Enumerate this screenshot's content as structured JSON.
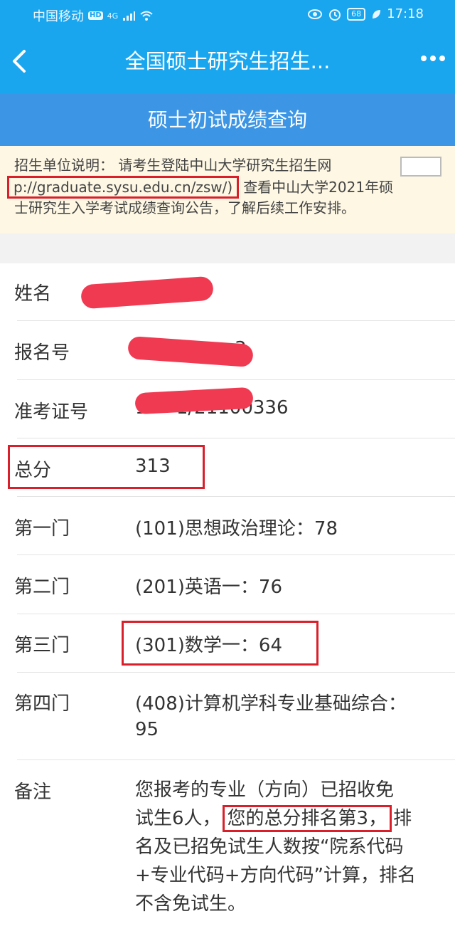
{
  "status_bar": {
    "carrier": "中国移动",
    "hd_badge": "HD",
    "net_badge": "4G",
    "battery": "68",
    "time": "17:18"
  },
  "nav": {
    "title": "全国硕士研究生招生..."
  },
  "sub_header": "硕士初试成绩查询",
  "notice": {
    "line1": "招生单位说明：  请考生登陆中山大学研究生招生网",
    "url": "p://graduate.sysu.edu.cn/zsw/)",
    "line2_rest": "查看中山大学2021年硕",
    "line3": "士研究生入学考试成绩查询公告，了解后续工作安排。"
  },
  "fields": {
    "name_label": "姓名",
    "name_value": "",
    "reg_label": "报名号",
    "reg_value": "3",
    "ticket_label": "准考证号",
    "ticket_value": "1·····1/21100336",
    "total_label": "总分",
    "total_value": "313",
    "subject1_label": "第一门",
    "subject1_value": "(101)思想政治理论：78",
    "subject2_label": "第二门",
    "subject2_value": "(201)英语一：76",
    "subject3_label": "第三门",
    "subject3_value": "(301)数学一：64",
    "subject4_label": "第四门",
    "subject4_value_line1": "(408)计算机学科专业基础综合：",
    "subject4_value_line2": "95",
    "remark_label": "备注",
    "remark_line1": "您报考的专业（方向）已招收免",
    "remark_line2_a": "试生6人，",
    "remark_line2_hl": "您的总分排名第3，",
    "remark_line2_b": "排",
    "remark_line3": "名及已招免试生人数按“院系代码",
    "remark_line4": "+专业代码+方向代码”计算，排名",
    "remark_line5": "不含免试生。"
  }
}
